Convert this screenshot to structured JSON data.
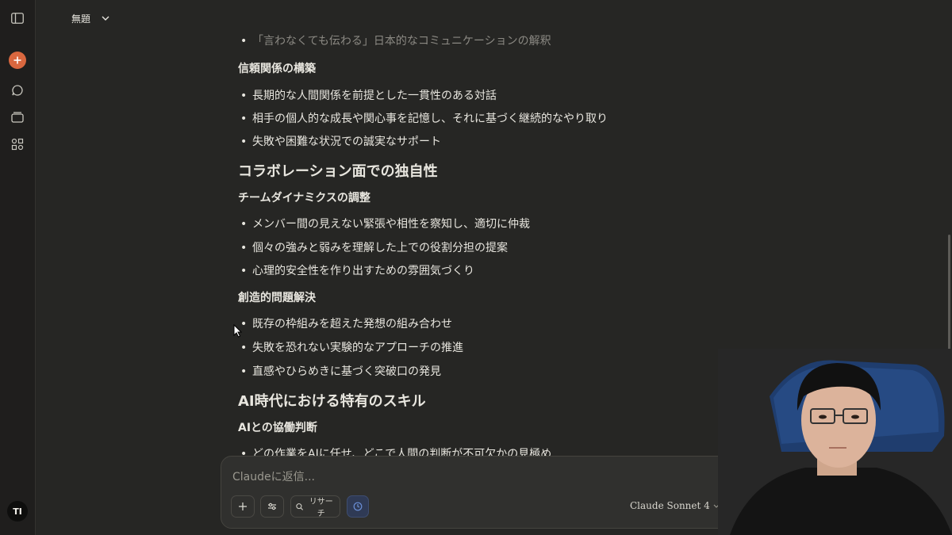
{
  "header": {
    "title": "無題"
  },
  "content": {
    "faded_bullet": "「言わなくても伝わる」日本的なコミュニケーションの解釈",
    "section_trust": {
      "heading": "信頼関係の構築",
      "items": [
        "長期的な人間関係を前提とした一貫性のある対話",
        "相手の個人的な成長や関心事を記憶し、それに基づく継続的なやり取り",
        "失敗や困難な状況での誠実なサポート"
      ]
    },
    "collab_heading": "コラボレーション面での独自性",
    "section_team": {
      "heading": "チームダイナミクスの調整",
      "items": [
        "メンバー間の見えない緊張や相性を察知し、適切に仲裁",
        "個々の強みと弱みを理解した上での役割分担の提案",
        "心理的安全性を作り出すための雰囲気づくり"
      ]
    },
    "section_creative": {
      "heading": "創造的問題解決",
      "items": [
        "既存の枠組みを超えた発想の組み合わせ",
        "失敗を恐れない実験的なアプローチの推進",
        "直感やひらめきに基づく突破口の発見"
      ]
    },
    "ai_heading": "AI時代における特有のスキル",
    "section_ai": {
      "heading": "AIとの協働判断",
      "cut_item": "どの作業をAIに任せ、どこで人間の判断が不可欠かの見極め"
    }
  },
  "composer": {
    "placeholder": "Claudeに返信...",
    "research_label": "リサーチ",
    "model_label": "Claude Sonnet 4"
  },
  "user": {
    "initials": "TI"
  },
  "colors": {
    "accent": "#d9673f",
    "background": "#262624",
    "sidebar": "#1f1e1d",
    "composer": "#30302e",
    "active_tool": "#6b8fd6"
  }
}
